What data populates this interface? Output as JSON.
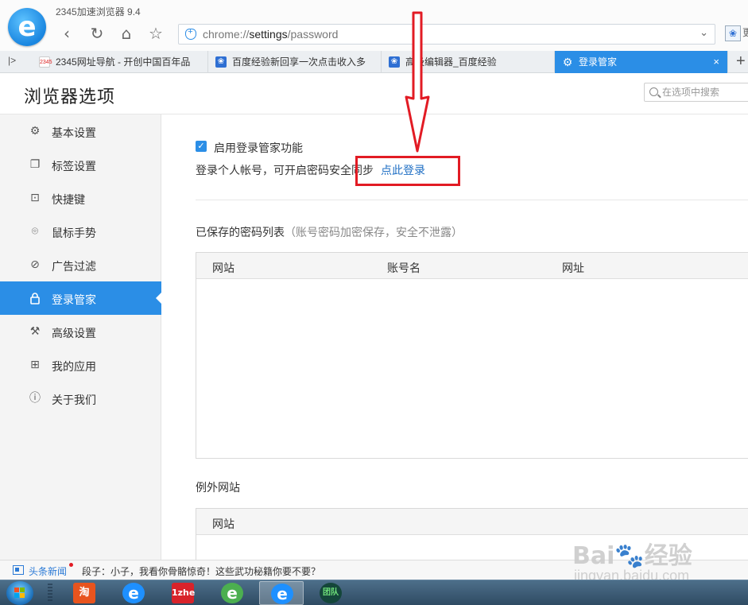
{
  "browser": {
    "app_title": "2345加速浏览器 9.4",
    "logo_letter": "e",
    "url_prefix": "chrome://",
    "url_host": "settings",
    "url_path": "/password",
    "extension_glyph": "❀",
    "extension_more": "更"
  },
  "tabs": [
    {
      "label": "2345网址导航 - 开创中国百年品",
      "icon": "2345-logo-icon",
      "active": false
    },
    {
      "label": "百度经验新回享一次点击收入多",
      "icon": "baidu-paw-icon",
      "active": false
    },
    {
      "label": "高级编辑器_百度经验",
      "icon": "baidu-paw-icon",
      "active": false
    },
    {
      "label": "登录管家",
      "icon": "gear-icon",
      "active": true
    }
  ],
  "tab_ui": {
    "toggle_glyph": "|>",
    "close_glyph": "×",
    "new_tab_glyph": "+",
    "logo_2345_text": "2345"
  },
  "page": {
    "title": "浏览器选项",
    "search_placeholder": "在选项中搜索"
  },
  "sidebar": {
    "items": [
      {
        "label": "基本设置",
        "icon": "gear-icon",
        "glyph": "⚙",
        "active": false
      },
      {
        "label": "标签设置",
        "icon": "tabs-icon",
        "glyph": "❐",
        "active": false
      },
      {
        "label": "快捷键",
        "icon": "shortcut-key-icon",
        "glyph": "⊡",
        "active": false
      },
      {
        "label": "鼠标手势",
        "icon": "mouse-icon",
        "glyph": "⌾",
        "active": false
      },
      {
        "label": "广告过滤",
        "icon": "block-icon",
        "glyph": "⊘",
        "active": false
      },
      {
        "label": "登录管家",
        "icon": "lock-icon",
        "glyph": "🔒",
        "active": true
      },
      {
        "label": "高级设置",
        "icon": "wrench-icon",
        "glyph": "⚒",
        "active": false
      },
      {
        "label": "我的应用",
        "icon": "apps-grid-icon",
        "glyph": "⊞",
        "active": false
      },
      {
        "label": "关于我们",
        "icon": "info-icon",
        "glyph": "ⓘ",
        "active": false
      }
    ]
  },
  "main": {
    "enable_checkbox": {
      "label": "启用登录管家功能",
      "checked": true,
      "check_glyph": "✓"
    },
    "login_tip": "登录个人帐号，可开启密码安全同步",
    "login_link": "点此登录",
    "saved_list": {
      "title": "已保存的密码列表",
      "subtitle": "（账号密码加密保存，安全不泄露）",
      "columns": [
        "网站",
        "账号名",
        "网址"
      ],
      "rows": []
    },
    "exceptions": {
      "title": "例外网站",
      "columns": [
        "网站"
      ],
      "rows": []
    }
  },
  "newsbar": {
    "label": "头条新闻",
    "text": "段子：小子，我看你骨骼惊奇！这些武功秘籍你要不要？"
  },
  "watermark": {
    "main": "Bai🐾经验",
    "sub": "jingyan.baidu.com"
  },
  "taskbar": {
    "apps": [
      {
        "name": "taobao-icon",
        "text": "淘",
        "color": "#e8541e"
      },
      {
        "name": "ie-browser-icon",
        "text": "e",
        "color": "#1e90ff"
      },
      {
        "name": "1zhe-icon",
        "text": "1zhe",
        "color": "#d8232a"
      },
      {
        "name": "green-e-icon",
        "text": "e",
        "color": "#4caf50"
      },
      {
        "name": "2345-browser-icon",
        "text": "e",
        "color": "#1e90ff",
        "active": true
      },
      {
        "name": "team-app-icon",
        "text": "团队",
        "color": "#14463a"
      }
    ]
  },
  "colors": {
    "accent": "#2b8ee6",
    "annotation": "#e21b24",
    "link": "#1f6fc4"
  }
}
